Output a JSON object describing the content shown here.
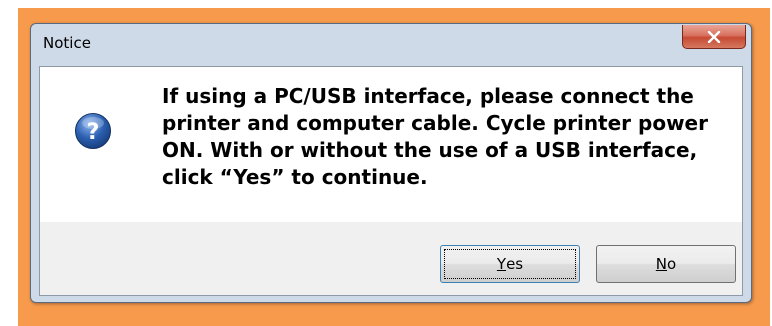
{
  "dialog": {
    "title": "Notice",
    "close_glyph": "X",
    "icon": "question-icon",
    "message": "If using a PC/USB interface, please connect the printer and computer cable. Cycle printer power ON.  With or without the use of a USB interface, click “Yes” to continue.",
    "buttons": {
      "yes": {
        "mnemonic": "Y",
        "rest": "es"
      },
      "no": {
        "mnemonic": "N",
        "rest": "o"
      }
    }
  },
  "colors": {
    "frame": "#f79a4c",
    "title_bar": "#cfdae8",
    "close_button": "#c64a34",
    "icon": "#2b5fb0"
  }
}
